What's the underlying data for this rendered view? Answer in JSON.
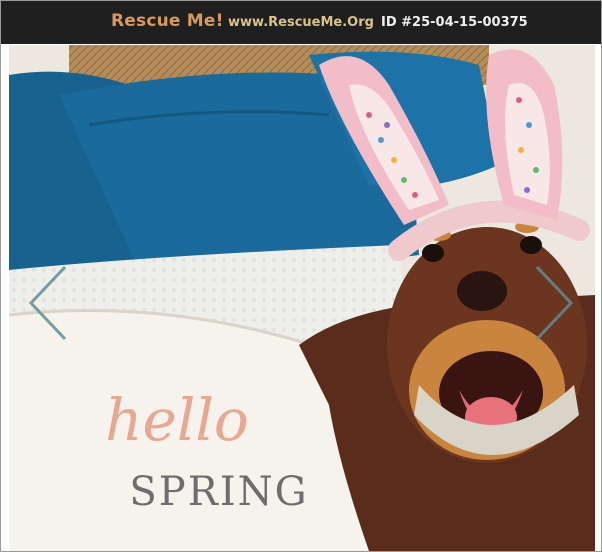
{
  "header": {
    "brand": "Rescue Me!",
    "site": "www.RescueMe.Org",
    "pet_id": "ID #25-04-15-00375"
  },
  "photo": {
    "pillow_line1": "hello",
    "pillow_line2": "SPRING"
  },
  "icons": {
    "prev": "chevron-left-icon",
    "next": "chevron-right-icon"
  },
  "colors": {
    "header_bg": "#1f1f1f",
    "brand": "#d99a56",
    "site": "#d9c38b",
    "arrow": "#5f8d93"
  }
}
